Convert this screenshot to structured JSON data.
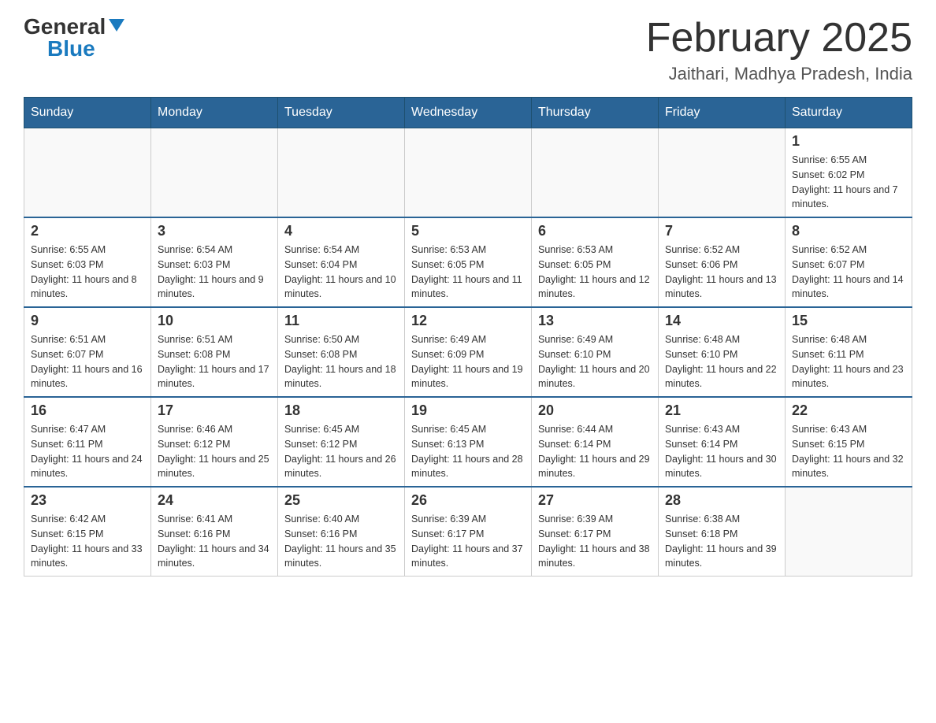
{
  "header": {
    "logo_general": "General",
    "logo_blue": "Blue",
    "month_title": "February 2025",
    "location": "Jaithari, Madhya Pradesh, India"
  },
  "days_of_week": [
    "Sunday",
    "Monday",
    "Tuesday",
    "Wednesday",
    "Thursday",
    "Friday",
    "Saturday"
  ],
  "weeks": [
    {
      "days": [
        {
          "date": "",
          "info": ""
        },
        {
          "date": "",
          "info": ""
        },
        {
          "date": "",
          "info": ""
        },
        {
          "date": "",
          "info": ""
        },
        {
          "date": "",
          "info": ""
        },
        {
          "date": "",
          "info": ""
        },
        {
          "date": "1",
          "info": "Sunrise: 6:55 AM\nSunset: 6:02 PM\nDaylight: 11 hours and 7 minutes."
        }
      ]
    },
    {
      "days": [
        {
          "date": "2",
          "info": "Sunrise: 6:55 AM\nSunset: 6:03 PM\nDaylight: 11 hours and 8 minutes."
        },
        {
          "date": "3",
          "info": "Sunrise: 6:54 AM\nSunset: 6:03 PM\nDaylight: 11 hours and 9 minutes."
        },
        {
          "date": "4",
          "info": "Sunrise: 6:54 AM\nSunset: 6:04 PM\nDaylight: 11 hours and 10 minutes."
        },
        {
          "date": "5",
          "info": "Sunrise: 6:53 AM\nSunset: 6:05 PM\nDaylight: 11 hours and 11 minutes."
        },
        {
          "date": "6",
          "info": "Sunrise: 6:53 AM\nSunset: 6:05 PM\nDaylight: 11 hours and 12 minutes."
        },
        {
          "date": "7",
          "info": "Sunrise: 6:52 AM\nSunset: 6:06 PM\nDaylight: 11 hours and 13 minutes."
        },
        {
          "date": "8",
          "info": "Sunrise: 6:52 AM\nSunset: 6:07 PM\nDaylight: 11 hours and 14 minutes."
        }
      ]
    },
    {
      "days": [
        {
          "date": "9",
          "info": "Sunrise: 6:51 AM\nSunset: 6:07 PM\nDaylight: 11 hours and 16 minutes."
        },
        {
          "date": "10",
          "info": "Sunrise: 6:51 AM\nSunset: 6:08 PM\nDaylight: 11 hours and 17 minutes."
        },
        {
          "date": "11",
          "info": "Sunrise: 6:50 AM\nSunset: 6:08 PM\nDaylight: 11 hours and 18 minutes."
        },
        {
          "date": "12",
          "info": "Sunrise: 6:49 AM\nSunset: 6:09 PM\nDaylight: 11 hours and 19 minutes."
        },
        {
          "date": "13",
          "info": "Sunrise: 6:49 AM\nSunset: 6:10 PM\nDaylight: 11 hours and 20 minutes."
        },
        {
          "date": "14",
          "info": "Sunrise: 6:48 AM\nSunset: 6:10 PM\nDaylight: 11 hours and 22 minutes."
        },
        {
          "date": "15",
          "info": "Sunrise: 6:48 AM\nSunset: 6:11 PM\nDaylight: 11 hours and 23 minutes."
        }
      ]
    },
    {
      "days": [
        {
          "date": "16",
          "info": "Sunrise: 6:47 AM\nSunset: 6:11 PM\nDaylight: 11 hours and 24 minutes."
        },
        {
          "date": "17",
          "info": "Sunrise: 6:46 AM\nSunset: 6:12 PM\nDaylight: 11 hours and 25 minutes."
        },
        {
          "date": "18",
          "info": "Sunrise: 6:45 AM\nSunset: 6:12 PM\nDaylight: 11 hours and 26 minutes."
        },
        {
          "date": "19",
          "info": "Sunrise: 6:45 AM\nSunset: 6:13 PM\nDaylight: 11 hours and 28 minutes."
        },
        {
          "date": "20",
          "info": "Sunrise: 6:44 AM\nSunset: 6:14 PM\nDaylight: 11 hours and 29 minutes."
        },
        {
          "date": "21",
          "info": "Sunrise: 6:43 AM\nSunset: 6:14 PM\nDaylight: 11 hours and 30 minutes."
        },
        {
          "date": "22",
          "info": "Sunrise: 6:43 AM\nSunset: 6:15 PM\nDaylight: 11 hours and 32 minutes."
        }
      ]
    },
    {
      "days": [
        {
          "date": "23",
          "info": "Sunrise: 6:42 AM\nSunset: 6:15 PM\nDaylight: 11 hours and 33 minutes."
        },
        {
          "date": "24",
          "info": "Sunrise: 6:41 AM\nSunset: 6:16 PM\nDaylight: 11 hours and 34 minutes."
        },
        {
          "date": "25",
          "info": "Sunrise: 6:40 AM\nSunset: 6:16 PM\nDaylight: 11 hours and 35 minutes."
        },
        {
          "date": "26",
          "info": "Sunrise: 6:39 AM\nSunset: 6:17 PM\nDaylight: 11 hours and 37 minutes."
        },
        {
          "date": "27",
          "info": "Sunrise: 6:39 AM\nSunset: 6:17 PM\nDaylight: 11 hours and 38 minutes."
        },
        {
          "date": "28",
          "info": "Sunrise: 6:38 AM\nSunset: 6:18 PM\nDaylight: 11 hours and 39 minutes."
        },
        {
          "date": "",
          "info": ""
        }
      ]
    }
  ]
}
